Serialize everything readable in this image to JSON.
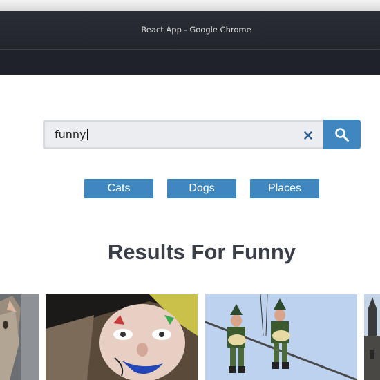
{
  "window": {
    "title": "React App - Google Chrome"
  },
  "search": {
    "value": "funny"
  },
  "categories": [
    "Cats",
    "Dogs",
    "Places"
  ],
  "results": {
    "heading": "Results For Funny",
    "images": [
      {
        "subject": "cat"
      },
      {
        "subject": "clown-face"
      },
      {
        "subject": "marionette-figures"
      },
      {
        "subject": "building"
      }
    ]
  },
  "icons": {
    "clear": "close-icon",
    "search": "search-icon"
  },
  "colors": {
    "accent": "#3f87bf",
    "heading": "#3a3f47",
    "input_bg": "#ebedf0"
  }
}
